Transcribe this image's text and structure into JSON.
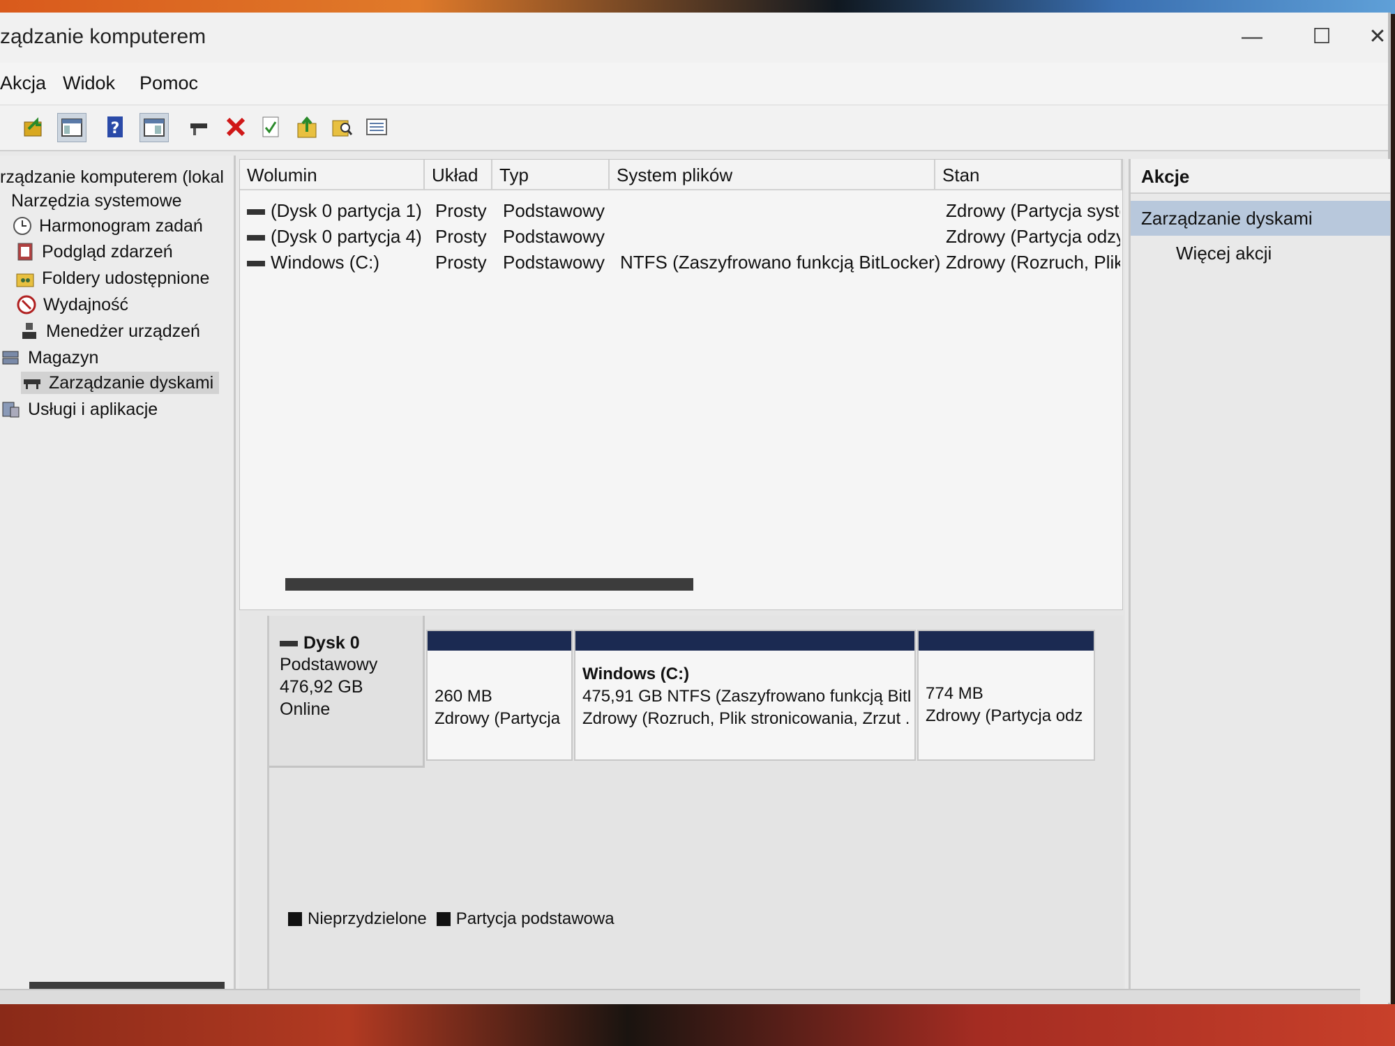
{
  "window": {
    "title": "ządzanie komputerem",
    "controls": {
      "minimize": "—",
      "maximize": "☐",
      "close": "✕"
    }
  },
  "menu": [
    "Akcja",
    "Widok",
    "Pomoc"
  ],
  "toolbar_icons": [
    "back-icon",
    "console-tree-icon",
    "help-icon",
    "show-hide-icon",
    "connect-drive-icon",
    "delete-icon",
    "properties-icon",
    "import-icon",
    "search-icon",
    "list-icon"
  ],
  "tree": {
    "root": "rządzanie komputerem (lokal",
    "system_tools": "Narzędzia systemowe",
    "task_scheduler": "Harmonogram zadań",
    "event_viewer": "Podgląd zdarzeń",
    "shared_folders": "Foldery udostępnione",
    "performance": "Wydajność",
    "device_manager": "Menedżer urządzeń",
    "storage": "Magazyn",
    "disk_management": "Zarządzanie dyskami",
    "services_apps": "Usługi i aplikacje"
  },
  "volumes": {
    "columns": [
      "Wolumin",
      "Układ",
      "Typ",
      "System plików",
      "Stan"
    ],
    "rows": [
      {
        "name": "(Dysk 0 partycja 1)",
        "layout": "Prosty",
        "type": "Podstawowy",
        "fs": "",
        "status": "Zdrowy (Partycja syste"
      },
      {
        "name": "(Dysk 0 partycja 4)",
        "layout": "Prosty",
        "type": "Podstawowy",
        "fs": "",
        "status": "Zdrowy (Partycja odzy"
      },
      {
        "name": "Windows (C:)",
        "layout": "Prosty",
        "type": "Podstawowy",
        "fs": "NTFS (Zaszyfrowano funkcją BitLocker)",
        "status": "Zdrowy (Rozruch, Plik"
      }
    ]
  },
  "disk": {
    "name": "Dysk 0",
    "type": "Podstawowy",
    "size": "476,92 GB",
    "state": "Online",
    "partitions": [
      {
        "title": "",
        "line1": "260 MB",
        "line2": "Zdrowy (Partycja"
      },
      {
        "title": "Windows  (C:)",
        "line1": "475,91 GB NTFS (Zaszyfrowano funkcją BitL",
        "line2": "Zdrowy (Rozruch, Plik stronicowania, Zrzut ."
      },
      {
        "title": "",
        "line1": "774 MB",
        "line2": "Zdrowy (Partycja odz"
      }
    ],
    "partition_color": "#1b2a52"
  },
  "legend": [
    "Nieprzydzielone",
    "Partycja podstawowa"
  ],
  "actions": {
    "header": "Akcje",
    "selected": "Zarządzanie dyskami",
    "more": "Więcej akcji"
  }
}
